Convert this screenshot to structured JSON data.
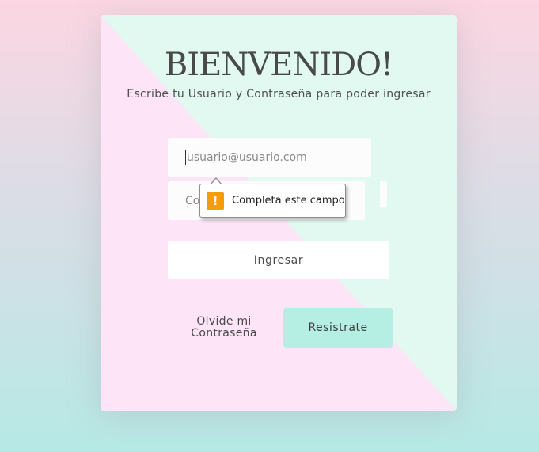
{
  "header": {
    "title": "BIENVENIDO!",
    "subtitle": "Escribe tu Usuario y Contraseña para poder ingresar"
  },
  "form": {
    "user_placeholder": "usuario@usuario.com",
    "password_placeholder_visible": "Co",
    "submit_label": "Ingresar"
  },
  "links": {
    "forgot_password": "Olvide mi Contraseña",
    "register_label": "Resistrate"
  },
  "tooltip": {
    "icon": "warning-icon",
    "icon_glyph": "!",
    "message": "Completa este campo"
  },
  "colors": {
    "card_mint": "#e1f9f0",
    "card_pink": "#fde4f6",
    "register_button": "#b5eee3",
    "warning": "#f59c09"
  }
}
